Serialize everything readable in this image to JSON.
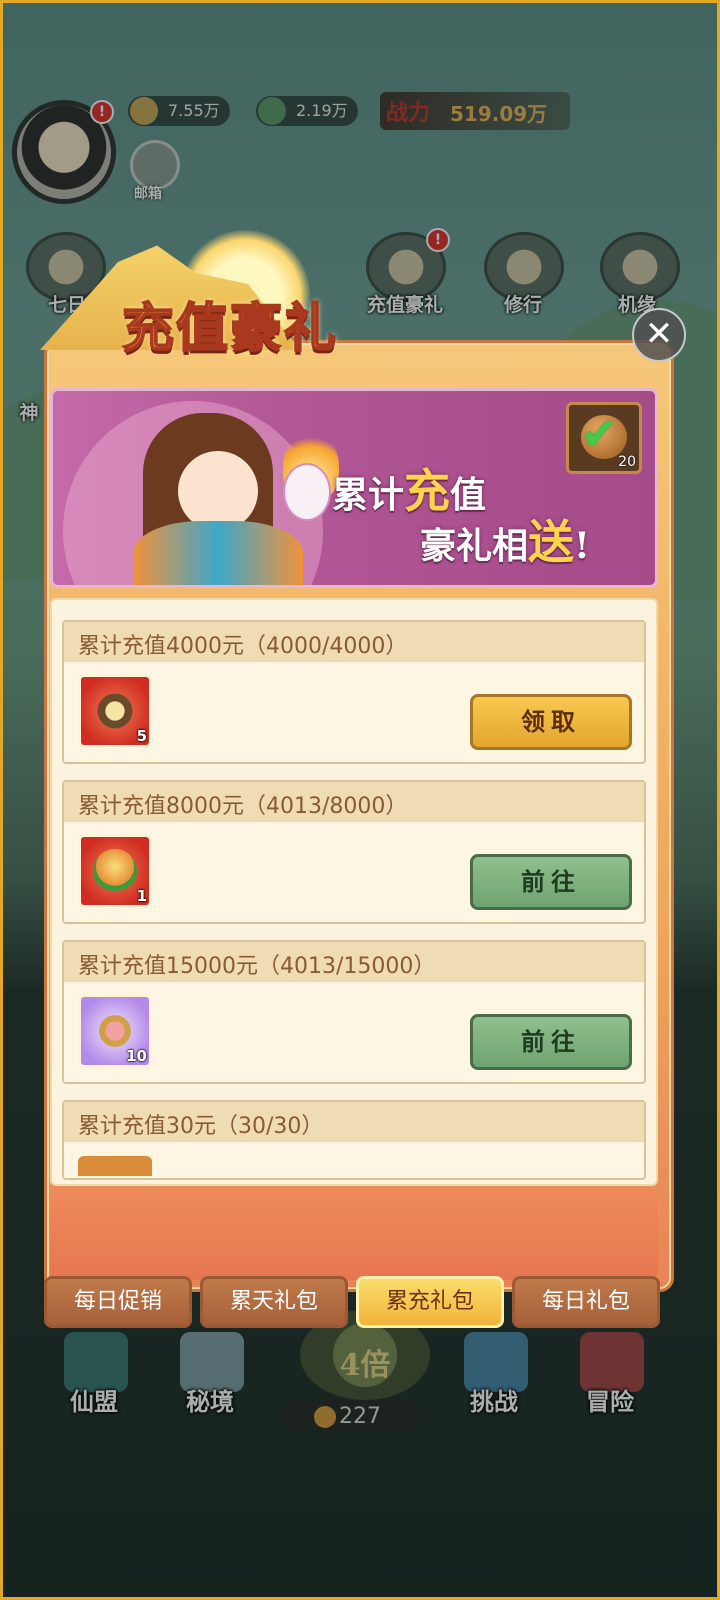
{
  "hud": {
    "currency1": "7.55万",
    "currency2": "2.19万",
    "power_label": "战力",
    "power_value": "519.09万",
    "mail_label": "邮箱",
    "top_icons": [
      "七日",
      "充值豪礼",
      "修行",
      "机缘"
    ],
    "side_icon": "神"
  },
  "panel": {
    "title": "充值豪礼",
    "slogan_line1_a": "累计",
    "slogan_line1_hl": "充",
    "slogan_line1_b": "值",
    "slogan_line2_a": "豪礼相",
    "slogan_line2_hl": "送",
    "slogan_line2_b": "!",
    "chest_count": "20",
    "rewards": [
      {
        "label": "累计充值4000元（4000/4000）",
        "item_count": "5",
        "button": "领取",
        "state": "claimable"
      },
      {
        "label": "累计充值8000元（4013/8000）",
        "item_count": "1",
        "button": "前往",
        "state": "goto"
      },
      {
        "label": "累计充值15000元（4013/15000）",
        "item_count": "10",
        "button": "前往",
        "state": "goto"
      },
      {
        "label": "累计充值30元（30/30）"
      }
    ]
  },
  "tabs": [
    "每日促销",
    "累天礼包",
    "累充礼包",
    "每日礼包"
  ],
  "active_tab": "累充礼包",
  "bottom_nav": {
    "items": [
      "仙盟",
      "秘境",
      "挑战",
      "冒险"
    ],
    "multiplier": "4倍",
    "counter": "227"
  },
  "colors": {
    "accent": "#f0b43a",
    "claim": "#e3a530",
    "goto": "#6ea471",
    "title": "#f6a63b"
  }
}
